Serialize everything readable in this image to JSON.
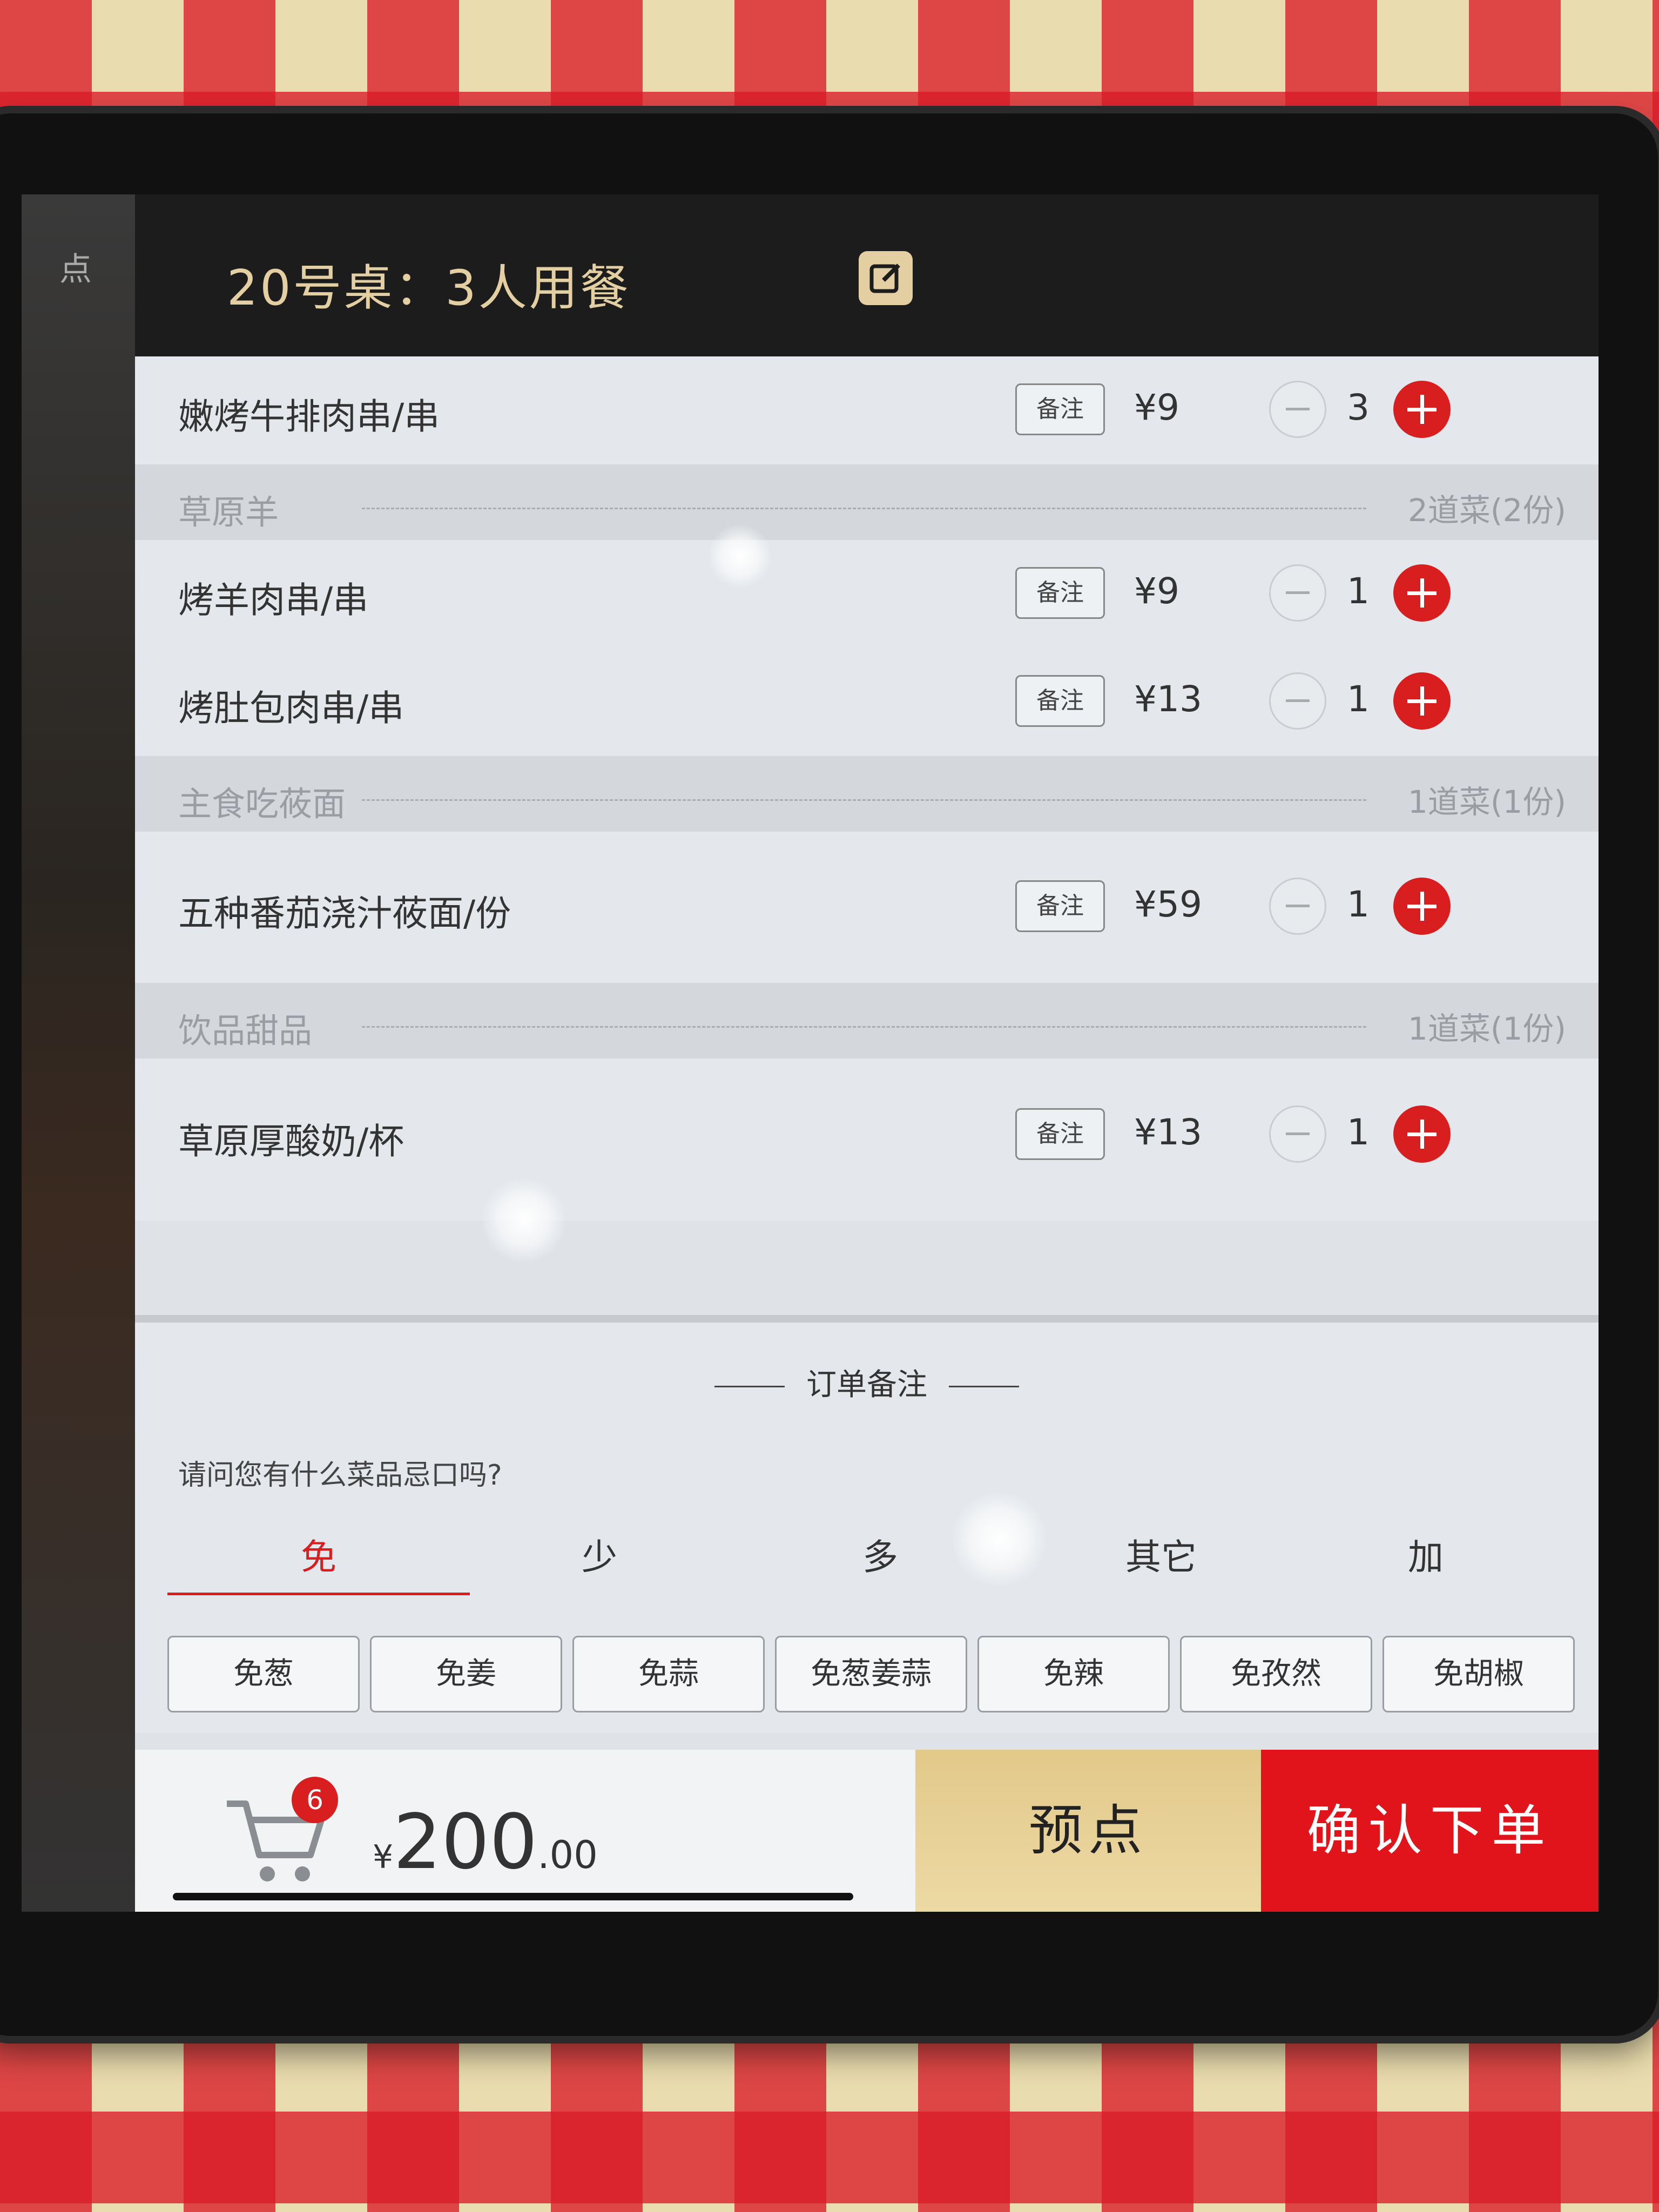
{
  "header": {
    "title": "20号桌：3人用餐",
    "edit_icon": "edit-icon"
  },
  "side_panel": {
    "tab_label": "点"
  },
  "sections": [
    {
      "type": "item",
      "name": "嫩烤牛排肉串/串",
      "note": "备注",
      "price": "¥9",
      "qty": "3"
    },
    {
      "type": "category",
      "name": "草原羊",
      "count": "2道菜(2份)"
    },
    {
      "type": "item",
      "name": "烤羊肉串/串",
      "note": "备注",
      "price": "¥9",
      "qty": "1"
    },
    {
      "type": "item",
      "name": "烤肚包肉串/串",
      "note": "备注",
      "price": "¥13",
      "qty": "1"
    },
    {
      "type": "category",
      "name": "主食吃莜面",
      "count": "1道菜(1份)"
    },
    {
      "type": "item",
      "name": "五种番茄浇汁莜面/份",
      "note": "备注",
      "price": "¥59",
      "qty": "1"
    },
    {
      "type": "category",
      "name": "饮品甜品",
      "count": "1道菜(1份)"
    },
    {
      "type": "item",
      "name": "草原厚酸奶/杯",
      "note": "备注",
      "price": "¥13",
      "qty": "1"
    }
  ],
  "remark": {
    "title": "订单备注",
    "question": "请问您有什么菜品忌口吗?",
    "tabs": [
      "免",
      "少",
      "多",
      "其它",
      "加"
    ],
    "active_tab": "免",
    "chips": [
      "免葱",
      "免姜",
      "免蒜",
      "免葱姜蒜",
      "免辣",
      "免孜然",
      "免胡椒"
    ]
  },
  "footer": {
    "cart_count": "6",
    "total_yen": "¥",
    "total_int": "200",
    "total_dec": ".00",
    "preorder_label": "预点",
    "confirm_label": "确认下单"
  },
  "colors": {
    "accent_red": "#d81e1e",
    "header_gold": "#e3cfa2",
    "preorder_gold": "#e2c98a"
  }
}
